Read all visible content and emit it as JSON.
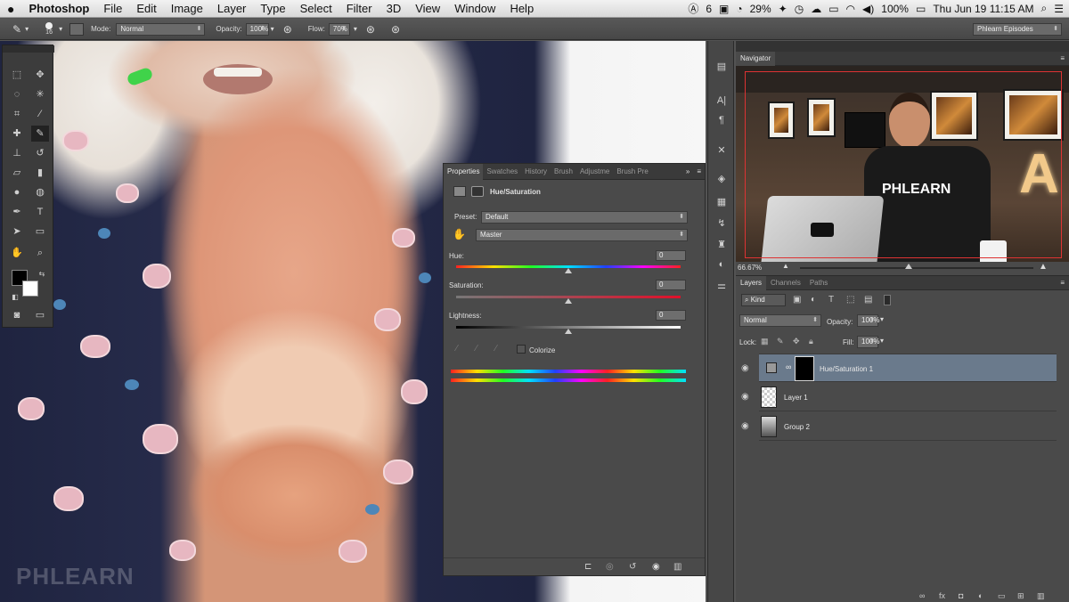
{
  "menubar": {
    "apple": "",
    "app_name": "Photoshop",
    "menus": [
      "File",
      "Edit",
      "Image",
      "Layer",
      "Type",
      "Select",
      "Filter",
      "3D",
      "View",
      "Window",
      "Help"
    ],
    "status": {
      "adobe_count": "6",
      "battery_small": "29%",
      "battery": "100%",
      "datetime": "Thu Jun 19  11:15 AM"
    }
  },
  "options_bar": {
    "brush_size": "16",
    "mode_label": "Mode:",
    "mode_value": "Normal",
    "opacity_label": "Opacity:",
    "opacity_value": "100%",
    "flow_label": "Flow:",
    "flow_value": "70%",
    "workspace": "Phlearn Episodes"
  },
  "canvas": {
    "watermark": "PHLEARN"
  },
  "properties_panel": {
    "tabs": [
      "Properties",
      "Swatches",
      "History",
      "Brush",
      "Adjustme",
      "Brush Pre"
    ],
    "adjustment_title": "Hue/Saturation",
    "preset_label": "Preset:",
    "preset_value": "Default",
    "channel_value": "Master",
    "hue_label": "Hue:",
    "hue_value": "0",
    "saturation_label": "Saturation:",
    "saturation_value": "0",
    "lightness_label": "Lightness:",
    "lightness_value": "0",
    "colorize_label": "Colorize",
    "colorize_checked": false
  },
  "navigator_panel": {
    "tab": "Navigator",
    "zoom": "66.67%",
    "shirt_text": "PHLEARN",
    "sign_letter": "A"
  },
  "layers_panel": {
    "tabs": [
      "Layers",
      "Channels",
      "Paths"
    ],
    "filter_kind": "Kind",
    "blend_mode": "Normal",
    "opacity_label": "Opacity:",
    "opacity_value": "100%",
    "lock_label": "Lock:",
    "fill_label": "Fill:",
    "fill_value": "100%",
    "layers": [
      {
        "name": "Hue/Saturation 1",
        "selected": true
      },
      {
        "name": "Layer 1",
        "selected": false
      },
      {
        "name": "Group 2",
        "selected": false
      }
    ]
  }
}
